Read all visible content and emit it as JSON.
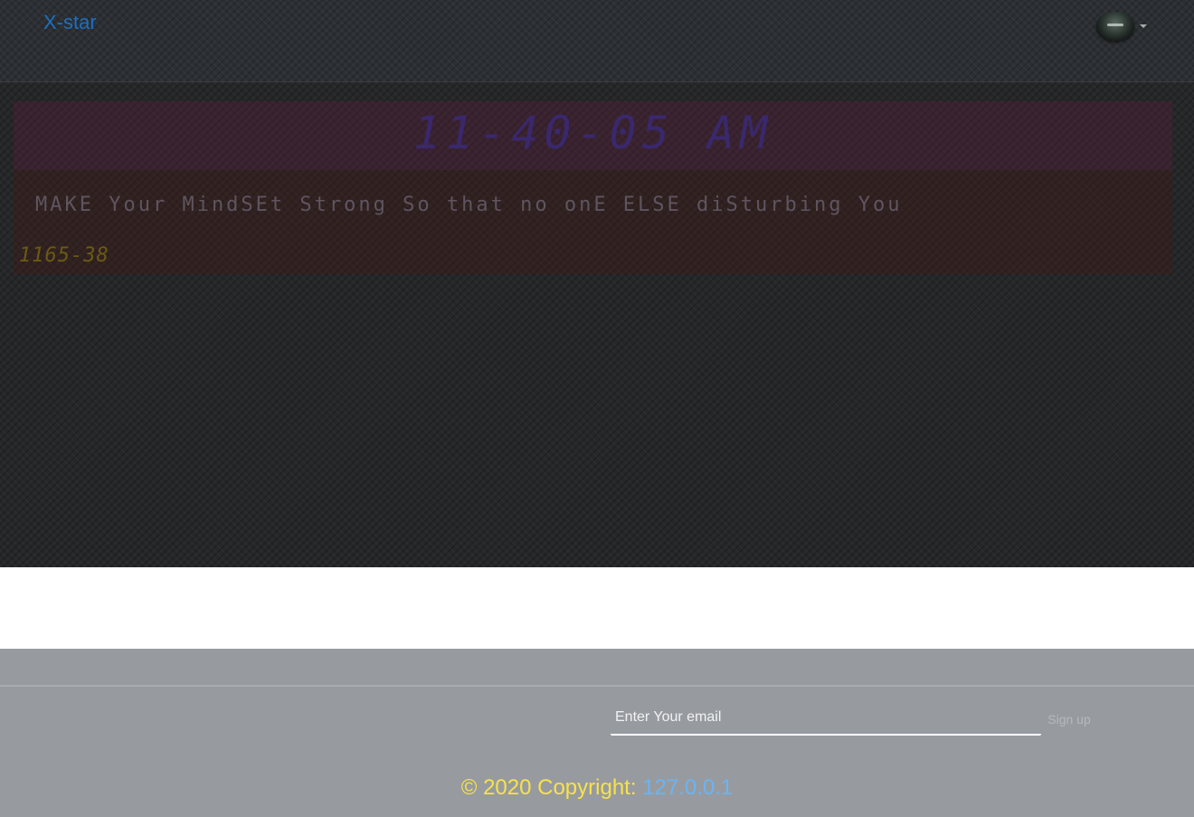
{
  "navbar": {
    "brand": "X-star",
    "avatar_icon": "user-avatar-icon",
    "caret_icon": "caret-down-icon"
  },
  "hero": {
    "clock": "11-40-05 AM",
    "quote": "MAKE Your MindSEt Strong So that no onE ELSE diSturbing You",
    "code": "1165-38"
  },
  "footer": {
    "email_placeholder": "Enter Your email",
    "signup_label": "Sign up",
    "copyright_prefix": "© 2020 Copyright: ",
    "copyright_link": "127.0.0.1"
  },
  "colors": {
    "brand": "#1d6fc0",
    "copyright_text": "#f7e24a",
    "copyright_link": "#6ab4f5",
    "footer_bg": "#979b9f"
  }
}
